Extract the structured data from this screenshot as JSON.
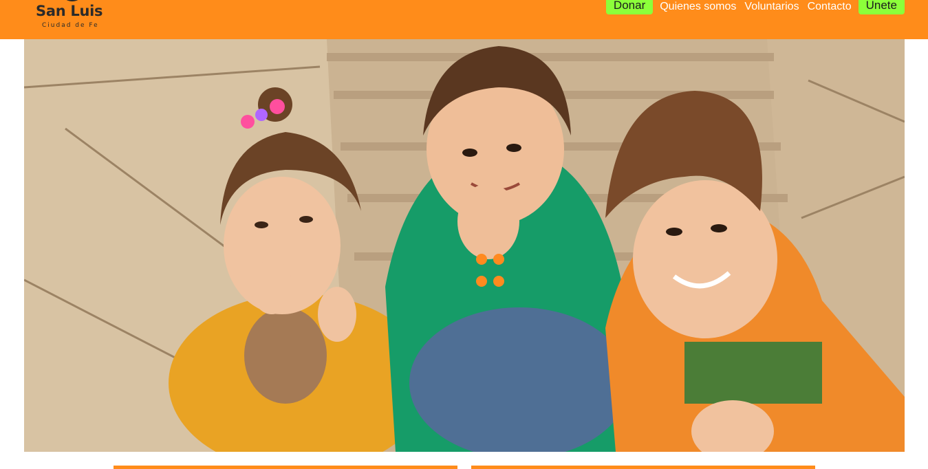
{
  "header": {
    "logo": {
      "title": "San Luis",
      "subtitle": "Ciudad de Fe"
    },
    "nav": {
      "donate": "Donar",
      "about": "Quienes somos",
      "volunteers": "Voluntarios",
      "contact": "Contacto",
      "join": "Unete"
    }
  },
  "colors": {
    "navbar_bg": "#ff8c1a",
    "cta_bg": "#8cff3a",
    "nav_text": "#ffffff"
  },
  "hero": {
    "image": "children-thumbs-up-on-stairs-photo"
  }
}
